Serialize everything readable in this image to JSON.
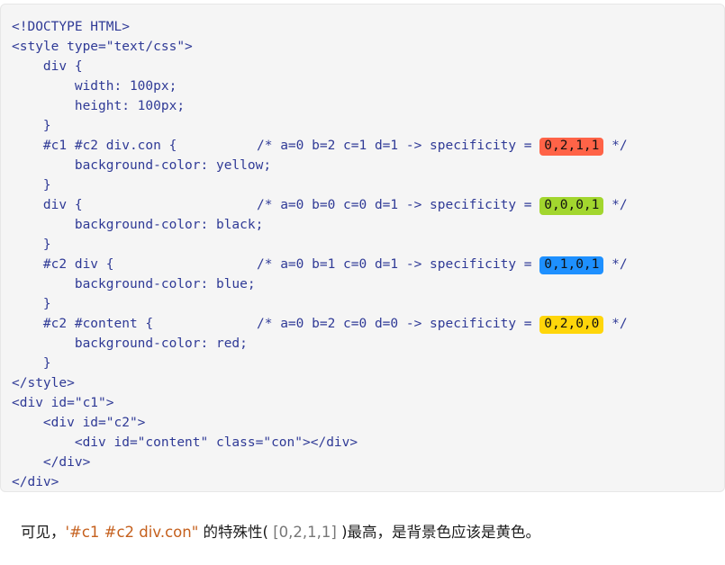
{
  "code_block": {
    "language": "html",
    "lines": [
      {
        "text": "<!DOCTYPE HTML>"
      },
      {
        "text": "<style type=\"text/css\">"
      },
      {
        "text": "    div {"
      },
      {
        "text": "        width: 100px;"
      },
      {
        "text": "        height: 100px;"
      },
      {
        "text": "    }"
      },
      {
        "text": "    #c1 #c2 div.con {",
        "comment_before": "/* a=0 b=2 c=1 d=1 -> specificity = ",
        "badge": "0,2,1,1",
        "badge_color": "#ff6347",
        "comment_after": " */"
      },
      {
        "text": "        background-color: yellow;"
      },
      {
        "text": "    }"
      },
      {
        "text": "    div {",
        "comment_before": "/* a=0 b=0 c=0 d=1 -> specificity = ",
        "badge": "0,0,0,1",
        "badge_color": "#a2d62e",
        "comment_after": " */"
      },
      {
        "text": "        background-color: black;"
      },
      {
        "text": "    }"
      },
      {
        "text": "    #c2 div {",
        "comment_before": "/* a=0 b=1 c=0 d=1 -> specificity = ",
        "badge": "0,1,0,1",
        "badge_color": "#1e90ff",
        "comment_after": " */"
      },
      {
        "text": "        background-color: blue;"
      },
      {
        "text": "    }"
      },
      {
        "text": "    #c2 #content {",
        "comment_before": "/* a=0 b=2 c=0 d=0 -> specificity = ",
        "badge": "0,2,0,0",
        "badge_color": "#ffd60a",
        "comment_after": " */"
      },
      {
        "text": "        background-color: red;"
      },
      {
        "text": "    }"
      },
      {
        "text": "</style>"
      },
      {
        "text": "<div id=\"c1\">"
      },
      {
        "text": "    <div id=\"c2\">"
      },
      {
        "text": "        <div id=\"content\" class=\"con\"></div>"
      },
      {
        "text": "    </div>"
      },
      {
        "text": "</div>"
      }
    ]
  },
  "caption": {
    "part1": "可见，",
    "selector": "'#c1 #c2 div.con\"",
    "part2": " 的特殊性( ",
    "specificity": "[0,2,1,1]",
    "part3": " )最高，是背景色应该是黄色。"
  }
}
